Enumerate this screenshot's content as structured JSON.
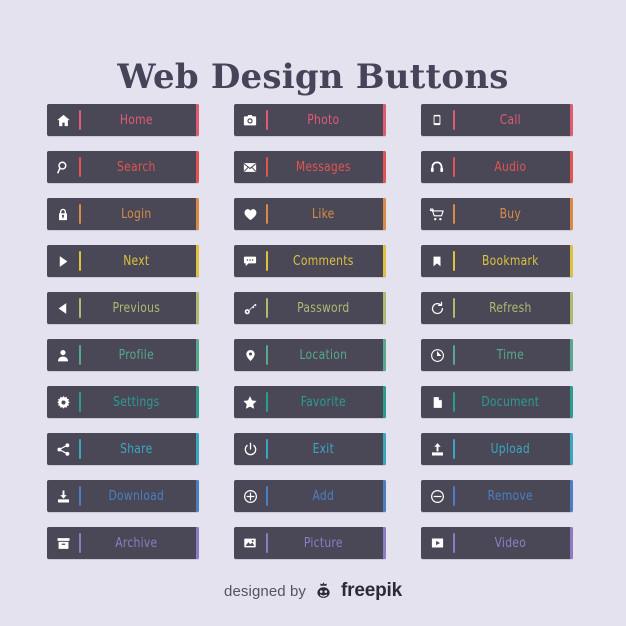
{
  "page": {
    "title": "Web Design Buttons",
    "background_color": "#e4e2ee",
    "button_background_color": "#4a4857",
    "icon_color": "#ffffff"
  },
  "footer": {
    "designed_by": "designed by",
    "brand": "freepik",
    "logo_icon": "freepik-robot-crown-icon"
  },
  "accent_colors": [
    "#e05a72",
    "#e0554f",
    "#d98b46",
    "#ddc13f",
    "#b2b871",
    "#56a98a",
    "#2a9d8f",
    "#3aa7bf",
    "#4a7fc1",
    "#8f7bc4"
  ],
  "columns": [
    {
      "name": "column-1",
      "buttons": [
        {
          "label": "Home",
          "icon": "home-icon",
          "color": "#e05a72"
        },
        {
          "label": "Search",
          "icon": "search-icon",
          "color": "#e0554f"
        },
        {
          "label": "Login",
          "icon": "lock-icon",
          "color": "#d98b46"
        },
        {
          "label": "Next",
          "icon": "play-right-icon",
          "color": "#ddc13f"
        },
        {
          "label": "Previous",
          "icon": "play-left-icon",
          "color": "#b2b871"
        },
        {
          "label": "Profile",
          "icon": "user-icon",
          "color": "#56a98a"
        },
        {
          "label": "Settings",
          "icon": "gear-icon",
          "color": "#2a9d8f"
        },
        {
          "label": "Share",
          "icon": "share-icon",
          "color": "#3aa7bf"
        },
        {
          "label": "Download",
          "icon": "download-icon",
          "color": "#4a7fc1"
        },
        {
          "label": "Archive",
          "icon": "archive-box-icon",
          "color": "#8f7bc4"
        }
      ]
    },
    {
      "name": "column-2",
      "buttons": [
        {
          "label": "Photo",
          "icon": "camera-icon",
          "color": "#e05a72"
        },
        {
          "label": "Messages",
          "icon": "envelope-icon",
          "color": "#e0554f"
        },
        {
          "label": "Like",
          "icon": "heart-icon",
          "color": "#d98b46"
        },
        {
          "label": "Comments",
          "icon": "speech-bubble-icon",
          "color": "#ddc13f"
        },
        {
          "label": "Password",
          "icon": "key-icon",
          "color": "#b2b871"
        },
        {
          "label": "Location",
          "icon": "map-pin-icon",
          "color": "#56a98a"
        },
        {
          "label": "Favorite",
          "icon": "star-icon",
          "color": "#2a9d8f"
        },
        {
          "label": "Exit",
          "icon": "power-icon",
          "color": "#3aa7bf"
        },
        {
          "label": "Add",
          "icon": "plus-circle-icon",
          "color": "#4a7fc1"
        },
        {
          "label": "Picture",
          "icon": "image-icon",
          "color": "#8f7bc4"
        }
      ]
    },
    {
      "name": "column-3",
      "buttons": [
        {
          "label": "Call",
          "icon": "phone-icon",
          "color": "#e05a72"
        },
        {
          "label": "Audio",
          "icon": "headphones-icon",
          "color": "#e0554f"
        },
        {
          "label": "Buy",
          "icon": "shopping-cart-icon",
          "color": "#d98b46"
        },
        {
          "label": "Bookmark",
          "icon": "bookmark-icon",
          "color": "#ddc13f"
        },
        {
          "label": "Refresh",
          "icon": "refresh-icon",
          "color": "#b2b871"
        },
        {
          "label": "Time",
          "icon": "clock-icon",
          "color": "#56a98a"
        },
        {
          "label": "Document",
          "icon": "document-icon",
          "color": "#2a9d8f"
        },
        {
          "label": "Upload",
          "icon": "upload-icon",
          "color": "#3aa7bf"
        },
        {
          "label": "Remove",
          "icon": "minus-circle-icon",
          "color": "#4a7fc1"
        },
        {
          "label": "Video",
          "icon": "video-play-icon",
          "color": "#8f7bc4"
        }
      ]
    }
  ]
}
